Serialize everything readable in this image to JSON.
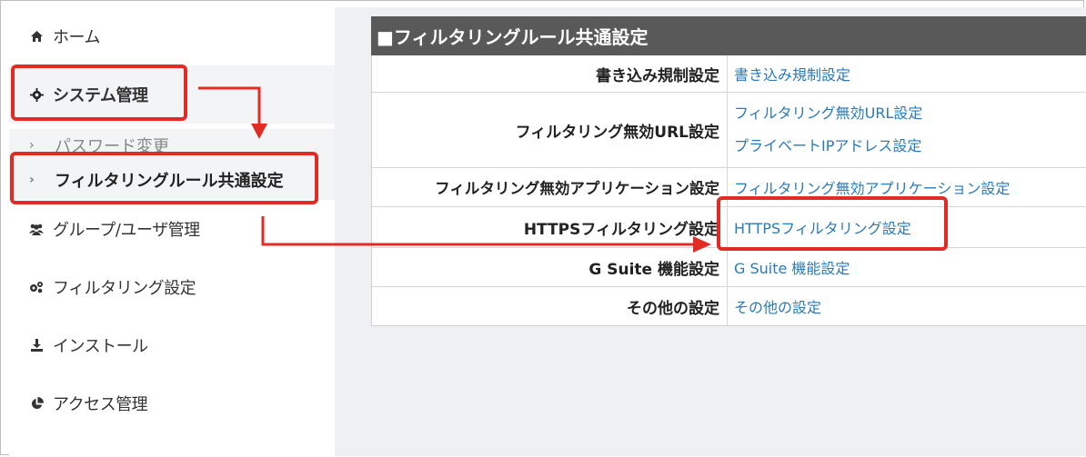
{
  "sidebar": {
    "items": [
      {
        "label": "ホーム",
        "icon": "home-icon"
      },
      {
        "label": "システム管理",
        "icon": "gear-icon"
      },
      {
        "label": "グループ/ユーザ管理",
        "icon": "users-icon"
      },
      {
        "label": "フィルタリング設定",
        "icon": "gears-icon"
      },
      {
        "label": "インストール",
        "icon": "download-icon"
      },
      {
        "label": "アクセス管理",
        "icon": "pie-chart-icon"
      }
    ],
    "subitems": [
      {
        "label": "パスワード変更",
        "icon": "chevron-right-icon"
      },
      {
        "label": "フィルタリングルール共通設定",
        "icon": "chevron-right-icon"
      }
    ]
  },
  "panel": {
    "title": "■フィルタリングルール共通設定",
    "rows": [
      {
        "label": "書き込み規制設定",
        "links": [
          "書き込み規制設定"
        ]
      },
      {
        "label": "フィルタリング無効URL設定",
        "links": [
          "フィルタリング無効URL設定",
          "プライベートIPアドレス設定"
        ]
      },
      {
        "label": "フィルタリング無効アプリケーション設定",
        "links": [
          "フィルタリング無効アプリケーション設定"
        ]
      },
      {
        "label": "HTTPSフィルタリング設定",
        "links": [
          "HTTPSフィルタリング設定"
        ]
      },
      {
        "label": "G Suite 機能設定",
        "links": [
          "G Suite 機能設定"
        ]
      },
      {
        "label": "その他の設定",
        "links": [
          "その他の設定"
        ]
      }
    ]
  },
  "colors": {
    "highlight": "#e32b25",
    "link": "#2a7ab8",
    "header_bg": "#595959"
  }
}
